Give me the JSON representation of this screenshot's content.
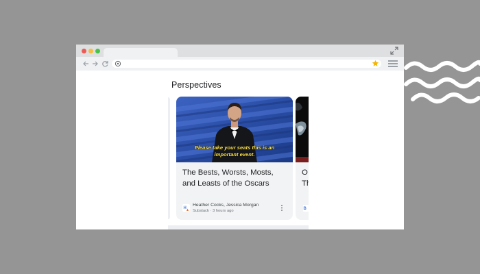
{
  "browser": {
    "omnibox_url": ""
  },
  "page": {
    "section_title": "Perspectives",
    "cards": [
      {
        "image_caption": "Please take your seats this is an important event.",
        "title": "The Bests, Worsts, Mosts, and Leasts of the Oscars",
        "author": "Heather Cocks, Jessica Morgan",
        "meta": "Substack · 3 hours ago",
        "source_icon": "substack-logo-icon"
      },
      {
        "title_partial": "O\nTh",
        "source_icon": "publisher-logo-icon"
      }
    ]
  },
  "colors": {
    "background": "#959595",
    "card_background": "#f1f3f4",
    "caption_yellow": "#ffe54c",
    "bookmark_star": "#f5b400",
    "stage_blue": "#2c4ea6"
  }
}
